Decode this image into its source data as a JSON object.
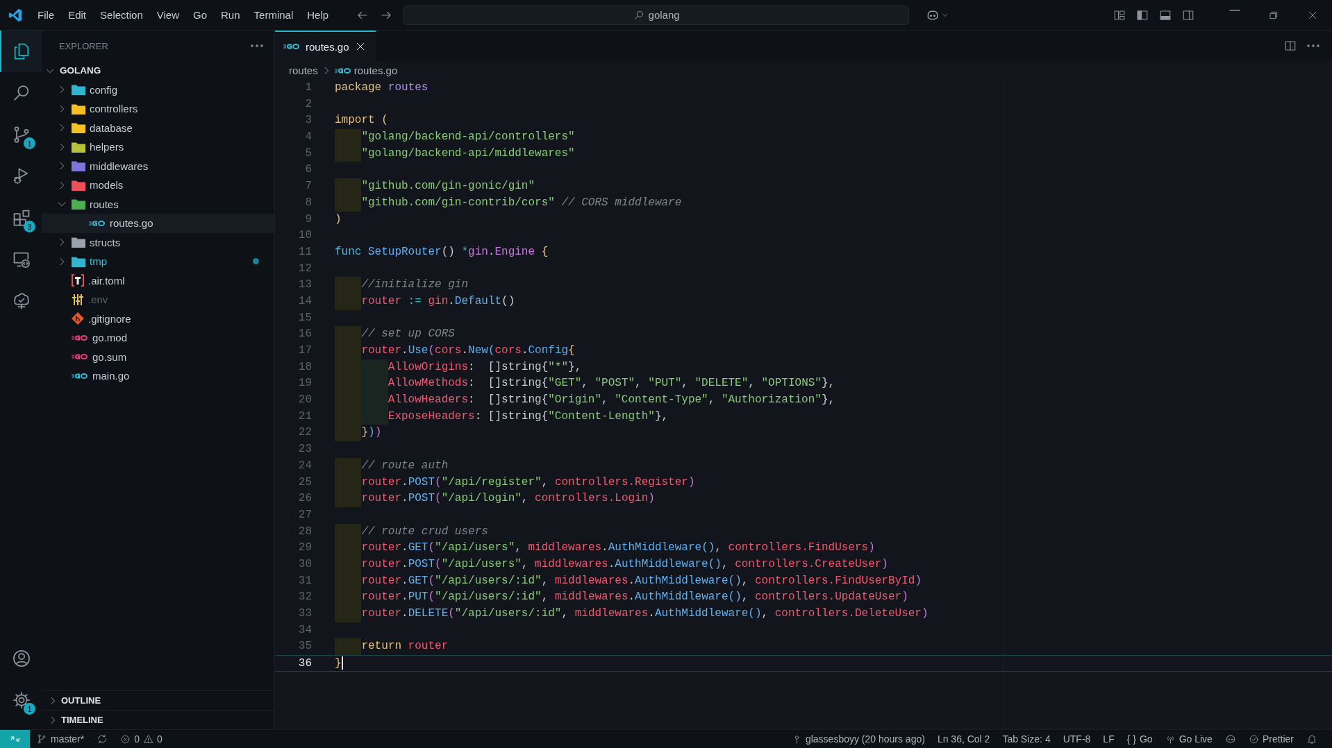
{
  "title_bar": {
    "menus": [
      "File",
      "Edit",
      "Selection",
      "View",
      "Go",
      "Run",
      "Terminal",
      "Help"
    ],
    "search": {
      "value": "golang"
    }
  },
  "activity_bar": {
    "items": [
      {
        "kind": "files",
        "selected": true
      },
      {
        "kind": "search",
        "selected": false
      },
      {
        "kind": "source-control",
        "selected": false,
        "badge": "1"
      },
      {
        "kind": "run-debug",
        "selected": false
      },
      {
        "kind": "extensions",
        "selected": false,
        "badge": "3"
      },
      {
        "kind": "remote",
        "selected": false
      },
      {
        "kind": "tree",
        "selected": false
      }
    ],
    "bottom": [
      {
        "kind": "account"
      },
      {
        "kind": "settings",
        "badge": "1"
      }
    ]
  },
  "sidebar": {
    "title": "EXPLORER",
    "root": {
      "label": "GOLANG",
      "expanded": true,
      "children": [
        {
          "label": "config",
          "kind": "folder",
          "color": "#2fb5d0",
          "expanded": false,
          "selected": false,
          "ignored": false,
          "modified": false
        },
        {
          "label": "controllers",
          "kind": "folder",
          "color": "#f5c022",
          "expanded": false,
          "selected": false,
          "ignored": false,
          "modified": false
        },
        {
          "label": "database",
          "kind": "folder",
          "color": "#f5c022",
          "expanded": false,
          "selected": false,
          "ignored": false,
          "modified": false
        },
        {
          "label": "helpers",
          "kind": "folder",
          "color": "#b7c23a",
          "expanded": false,
          "selected": false,
          "ignored": false,
          "modified": false
        },
        {
          "label": "middlewares",
          "kind": "folder",
          "color": "#7e75d8",
          "expanded": false,
          "selected": false,
          "ignored": false,
          "modified": false
        },
        {
          "label": "models",
          "kind": "folder",
          "color": "#ef4f5a",
          "expanded": false,
          "selected": false,
          "ignored": false,
          "modified": false
        },
        {
          "label": "routes",
          "kind": "folder",
          "color": "#4caf50",
          "expanded": true,
          "selected": false,
          "ignored": false,
          "modified": false,
          "children": [
            {
              "label": "routes.go",
              "kind": "go",
              "color": "#33b8d4",
              "selected": true,
              "ignored": false,
              "modified": false
            }
          ]
        },
        {
          "label": "structs",
          "kind": "folder",
          "color": "#9aa3ad",
          "expanded": false,
          "selected": false,
          "ignored": false,
          "modified": false
        },
        {
          "label": "tmp",
          "kind": "folder",
          "color": "#2fb5d0",
          "expanded": false,
          "selected": false,
          "ignored": false,
          "modified": true
        },
        {
          "label": ".air.toml",
          "kind": "toml",
          "color": "#d9534f",
          "selected": false,
          "ignored": false,
          "modified": false
        },
        {
          "label": ".env",
          "kind": "env",
          "color": "#e8c547",
          "selected": false,
          "ignored": true,
          "modified": false
        },
        {
          "label": ".gitignore",
          "kind": "git",
          "color": "#e4572e",
          "selected": false,
          "ignored": false,
          "modified": false
        },
        {
          "label": "go.mod",
          "kind": "go",
          "color": "#e5427a",
          "selected": false,
          "ignored": false,
          "modified": false
        },
        {
          "label": "go.sum",
          "kind": "go",
          "color": "#e5427a",
          "selected": false,
          "ignored": false,
          "modified": false
        },
        {
          "label": "main.go",
          "kind": "go",
          "color": "#33b8d4",
          "selected": false,
          "ignored": false,
          "modified": false
        }
      ]
    },
    "sections": [
      {
        "label": "OUTLINE",
        "expanded": false
      },
      {
        "label": "TIMELINE",
        "expanded": false
      }
    ]
  },
  "editor": {
    "tabs": [
      {
        "label": "routes.go",
        "selected": true
      }
    ],
    "breadcrumbs": [
      "routes",
      "routes.go"
    ],
    "lines": [
      {
        "number": "1",
        "current": false,
        "tokens": [
          {
            "kind": "keyword",
            "text": "package"
          },
          {
            "kind": "namespace",
            "text": " routes"
          }
        ]
      },
      {
        "number": "2",
        "current": false
      },
      {
        "number": "3",
        "current": false,
        "tokens": [
          {
            "kind": "keyword",
            "text": "import"
          },
          {
            "kind": "bracket",
            "text": " ("
          }
        ]
      },
      {
        "number": "4",
        "current": false,
        "tokens": [
          {
            "kind": "string",
            "text": "    \"golang/backend-api/controllers\""
          }
        ]
      },
      {
        "number": "5",
        "current": false,
        "tokens": [
          {
            "kind": "string",
            "text": "    \"golang/backend-api/middlewares\""
          }
        ]
      },
      {
        "number": "6",
        "current": false
      },
      {
        "number": "7",
        "current": false,
        "tokens": [
          {
            "kind": "string",
            "text": "    \"github.com/gin-gonic/gin\""
          }
        ]
      },
      {
        "number": "8",
        "current": false,
        "tokens": [
          {
            "kind": "string",
            "text": "    \"github.com/gin-contrib/cors\""
          },
          {
            "kind": "comment",
            "text": " // CORS middleware"
          }
        ]
      },
      {
        "number": "9",
        "current": false,
        "tokens": [
          {
            "kind": "bracket",
            "text": ")"
          }
        ]
      },
      {
        "number": "10",
        "current": false
      },
      {
        "number": "11",
        "current": false,
        "tokens": [
          {
            "kind": "storage",
            "text": "func"
          },
          {
            "kind": "function",
            "text": " SetupRouter"
          },
          {
            "kind": "punctuation",
            "text": "()"
          },
          {
            "kind": "operator",
            "text": " *"
          },
          {
            "kind": "type",
            "text": "gin"
          },
          {
            "kind": "punctuation",
            "text": "."
          },
          {
            "kind": "type",
            "text": "Engine"
          },
          {
            "kind": "bracket",
            "text": " {"
          }
        ]
      },
      {
        "number": "12",
        "current": false
      },
      {
        "number": "13",
        "current": false,
        "tokens": [
          {
            "kind": "comment",
            "text": "    //initialize gin"
          }
        ]
      },
      {
        "number": "14",
        "current": false,
        "tokens": [
          {
            "kind": "variable",
            "text": "    router"
          },
          {
            "kind": "operator",
            "text": " := "
          },
          {
            "kind": "variable",
            "text": "gin"
          },
          {
            "kind": "punctuation",
            "text": "."
          },
          {
            "kind": "function",
            "text": "Default"
          },
          {
            "kind": "punctuation",
            "text": "()"
          }
        ]
      },
      {
        "number": "15",
        "current": false
      },
      {
        "number": "16",
        "current": false,
        "tokens": [
          {
            "kind": "comment",
            "text": "    // set up CORS"
          }
        ]
      },
      {
        "number": "17",
        "current": false,
        "tokens": [
          {
            "kind": "variable",
            "text": "    router"
          },
          {
            "kind": "punctuation",
            "text": "."
          },
          {
            "kind": "function",
            "text": "Use"
          },
          {
            "kind": "bracket2",
            "text": "("
          },
          {
            "kind": "variable",
            "text": "cors"
          },
          {
            "kind": "punctuation",
            "text": "."
          },
          {
            "kind": "function",
            "text": "New"
          },
          {
            "kind": "bracket3",
            "text": "("
          },
          {
            "kind": "variable",
            "text": "cors"
          },
          {
            "kind": "punctuation",
            "text": "."
          },
          {
            "kind": "function",
            "text": "Config"
          },
          {
            "kind": "bracket",
            "text": "{"
          }
        ]
      },
      {
        "number": "18",
        "current": false,
        "tokens": [
          {
            "kind": "variable",
            "text": "        AllowOrigins"
          },
          {
            "kind": "punctuation",
            "text": ":  []string{"
          },
          {
            "kind": "string",
            "text": "\"*\""
          },
          {
            "kind": "punctuation",
            "text": "},"
          }
        ]
      },
      {
        "number": "19",
        "current": false,
        "tokens": [
          {
            "kind": "variable",
            "text": "        AllowMethods"
          },
          {
            "kind": "punctuation",
            "text": ":  []string{"
          },
          {
            "kind": "string",
            "text": "\"GET\""
          },
          {
            "kind": "punctuation",
            "text": ", "
          },
          {
            "kind": "string",
            "text": "\"POST\""
          },
          {
            "kind": "punctuation",
            "text": ", "
          },
          {
            "kind": "string",
            "text": "\"PUT\""
          },
          {
            "kind": "punctuation",
            "text": ", "
          },
          {
            "kind": "string",
            "text": "\"DELETE\""
          },
          {
            "kind": "punctuation",
            "text": ", "
          },
          {
            "kind": "string",
            "text": "\"OPTIONS\""
          },
          {
            "kind": "punctuation",
            "text": "},"
          }
        ]
      },
      {
        "number": "20",
        "current": false,
        "tokens": [
          {
            "kind": "variable",
            "text": "        AllowHeaders"
          },
          {
            "kind": "punctuation",
            "text": ":  []string{"
          },
          {
            "kind": "string",
            "text": "\"Origin\""
          },
          {
            "kind": "punctuation",
            "text": ", "
          },
          {
            "kind": "string",
            "text": "\"Content-Type\""
          },
          {
            "kind": "punctuation",
            "text": ", "
          },
          {
            "kind": "string",
            "text": "\"Authorization\""
          },
          {
            "kind": "punctuation",
            "text": "},"
          }
        ]
      },
      {
        "number": "21",
        "current": false,
        "tokens": [
          {
            "kind": "variable",
            "text": "        ExposeHeaders"
          },
          {
            "kind": "punctuation",
            "text": ": []string{"
          },
          {
            "kind": "string",
            "text": "\"Content-Length\""
          },
          {
            "kind": "punctuation",
            "text": "},"
          }
        ]
      },
      {
        "number": "22",
        "current": false,
        "tokens": [
          {
            "kind": "bracket",
            "text": "    }"
          },
          {
            "kind": "bracket3",
            "text": ")"
          },
          {
            "kind": "bracket2",
            "text": ")"
          }
        ]
      },
      {
        "number": "23",
        "current": false
      },
      {
        "number": "24",
        "current": false,
        "tokens": [
          {
            "kind": "comment",
            "text": "    // route auth"
          }
        ]
      },
      {
        "number": "25",
        "current": false,
        "tokens": [
          {
            "kind": "variable",
            "text": "    router"
          },
          {
            "kind": "punctuation",
            "text": "."
          },
          {
            "kind": "function",
            "text": "POST"
          },
          {
            "kind": "bracket2",
            "text": "("
          },
          {
            "kind": "string",
            "text": "\"/api/register\""
          },
          {
            "kind": "punctuation",
            "text": ", "
          },
          {
            "kind": "variable",
            "text": "controllers.Register"
          },
          {
            "kind": "bracket2",
            "text": ")"
          }
        ]
      },
      {
        "number": "26",
        "current": false,
        "tokens": [
          {
            "kind": "variable",
            "text": "    router"
          },
          {
            "kind": "punctuation",
            "text": "."
          },
          {
            "kind": "function",
            "text": "POST"
          },
          {
            "kind": "bracket2",
            "text": "("
          },
          {
            "kind": "string",
            "text": "\"/api/login\""
          },
          {
            "kind": "punctuation",
            "text": ", "
          },
          {
            "kind": "variable",
            "text": "controllers.Login"
          },
          {
            "kind": "bracket2",
            "text": ")"
          }
        ]
      },
      {
        "number": "27",
        "current": false
      },
      {
        "number": "28",
        "current": false,
        "tokens": [
          {
            "kind": "comment",
            "text": "    // route crud users"
          }
        ]
      },
      {
        "number": "29",
        "current": false,
        "tokens": [
          {
            "kind": "variable",
            "text": "    router"
          },
          {
            "kind": "punctuation",
            "text": "."
          },
          {
            "kind": "function",
            "text": "GET"
          },
          {
            "kind": "bracket2",
            "text": "("
          },
          {
            "kind": "string",
            "text": "\"/api/users\""
          },
          {
            "kind": "punctuation",
            "text": ", "
          },
          {
            "kind": "variable",
            "text": "middlewares"
          },
          {
            "kind": "punctuation",
            "text": "."
          },
          {
            "kind": "function",
            "text": "AuthMiddleware"
          },
          {
            "kind": "bracket3",
            "text": "()"
          },
          {
            "kind": "punctuation",
            "text": ", "
          },
          {
            "kind": "variable",
            "text": "controllers.FindUsers"
          },
          {
            "kind": "bracket2",
            "text": ")"
          }
        ]
      },
      {
        "number": "30",
        "current": false,
        "tokens": [
          {
            "kind": "variable",
            "text": "    router"
          },
          {
            "kind": "punctuation",
            "text": "."
          },
          {
            "kind": "function",
            "text": "POST"
          },
          {
            "kind": "bracket2",
            "text": "("
          },
          {
            "kind": "string",
            "text": "\"/api/users\""
          },
          {
            "kind": "punctuation",
            "text": ", "
          },
          {
            "kind": "variable",
            "text": "middlewares"
          },
          {
            "kind": "punctuation",
            "text": "."
          },
          {
            "kind": "function",
            "text": "AuthMiddleware"
          },
          {
            "kind": "bracket3",
            "text": "()"
          },
          {
            "kind": "punctuation",
            "text": ", "
          },
          {
            "kind": "variable",
            "text": "controllers.CreateUser"
          },
          {
            "kind": "bracket2",
            "text": ")"
          }
        ]
      },
      {
        "number": "31",
        "current": false,
        "tokens": [
          {
            "kind": "variable",
            "text": "    router"
          },
          {
            "kind": "punctuation",
            "text": "."
          },
          {
            "kind": "function",
            "text": "GET"
          },
          {
            "kind": "bracket2",
            "text": "("
          },
          {
            "kind": "string",
            "text": "\"/api/users/:id\""
          },
          {
            "kind": "punctuation",
            "text": ", "
          },
          {
            "kind": "variable",
            "text": "middlewares"
          },
          {
            "kind": "punctuation",
            "text": "."
          },
          {
            "kind": "function",
            "text": "AuthMiddleware"
          },
          {
            "kind": "bracket3",
            "text": "()"
          },
          {
            "kind": "punctuation",
            "text": ", "
          },
          {
            "kind": "variable",
            "text": "controllers.FindUserById"
          },
          {
            "kind": "bracket2",
            "text": ")"
          }
        ]
      },
      {
        "number": "32",
        "current": false,
        "tokens": [
          {
            "kind": "variable",
            "text": "    router"
          },
          {
            "kind": "punctuation",
            "text": "."
          },
          {
            "kind": "function",
            "text": "PUT"
          },
          {
            "kind": "bracket2",
            "text": "("
          },
          {
            "kind": "string",
            "text": "\"/api/users/:id\""
          },
          {
            "kind": "punctuation",
            "text": ", "
          },
          {
            "kind": "variable",
            "text": "middlewares"
          },
          {
            "kind": "punctuation",
            "text": "."
          },
          {
            "kind": "function",
            "text": "AuthMiddleware"
          },
          {
            "kind": "bracket3",
            "text": "()"
          },
          {
            "kind": "punctuation",
            "text": ", "
          },
          {
            "kind": "variable",
            "text": "controllers.UpdateUser"
          },
          {
            "kind": "bracket2",
            "text": ")"
          }
        ]
      },
      {
        "number": "33",
        "current": false,
        "tokens": [
          {
            "kind": "variable",
            "text": "    router"
          },
          {
            "kind": "punctuation",
            "text": "."
          },
          {
            "kind": "function",
            "text": "DELETE"
          },
          {
            "kind": "bracket2",
            "text": "("
          },
          {
            "kind": "string",
            "text": "\"/api/users/:id\""
          },
          {
            "kind": "punctuation",
            "text": ", "
          },
          {
            "kind": "variable",
            "text": "middlewares"
          },
          {
            "kind": "punctuation",
            "text": "."
          },
          {
            "kind": "function",
            "text": "AuthMiddleware"
          },
          {
            "kind": "bracket3",
            "text": "()"
          },
          {
            "kind": "punctuation",
            "text": ", "
          },
          {
            "kind": "variable",
            "text": "controllers.DeleteUser"
          },
          {
            "kind": "bracket2",
            "text": ")"
          }
        ]
      },
      {
        "number": "34",
        "current": false
      },
      {
        "number": "35",
        "current": false,
        "tokens": [
          {
            "kind": "keyword",
            "text": "    return"
          },
          {
            "kind": "variable",
            "text": " router"
          }
        ]
      },
      {
        "number": "36",
        "current": true,
        "tokens": [
          {
            "kind": "bracket",
            "text": "}"
          }
        ]
      }
    ]
  },
  "status_bar": {
    "branch": "master*",
    "errors": "0",
    "warnings": "0",
    "right": [
      {
        "kind": "blame",
        "text": "glassesboyy (20 hours ago)"
      },
      {
        "kind": "text",
        "text": "Ln 36, Col 2"
      },
      {
        "kind": "text",
        "text": "Tab Size: 4"
      },
      {
        "kind": "text",
        "text": "UTF-8"
      },
      {
        "kind": "text",
        "text": "LF"
      },
      {
        "kind": "language",
        "symbol": "{ }",
        "text": "Go"
      },
      {
        "kind": "live",
        "text": "Go Live"
      },
      {
        "kind": "copilot"
      },
      {
        "kind": "prettier",
        "text": "Prettier"
      },
      {
        "kind": "bell"
      }
    ]
  }
}
